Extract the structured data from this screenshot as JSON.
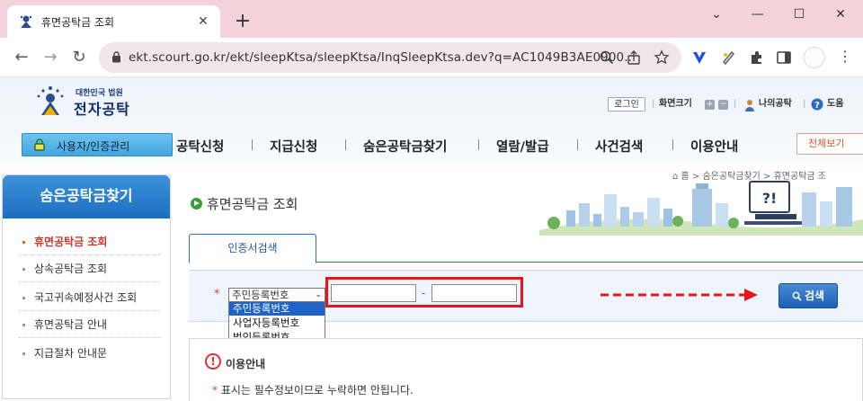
{
  "browser": {
    "tab_title": "휴면공탁금 조회",
    "tab_close": "✕",
    "new_tab": "+",
    "url": "ekt.scourt.go.kr/ekt/sleepKtsa/sleepKtsa/InqSleepKtsa.dev?q=AC1049B3AE0900...",
    "window_controls": [
      "⌄",
      "—",
      "☐",
      "✕"
    ],
    "icons": [
      "back-icon",
      "forward-icon",
      "reload-icon",
      "lock-icon",
      "zoom-icon",
      "share-icon",
      "bookmark-star-icon",
      "extension-icons",
      "puzzle-icon",
      "sidepanel-icon",
      "profile-icon",
      "menu-icon"
    ]
  },
  "site": {
    "logo_small": "대한민국 법원",
    "logo_big": "전자공탁",
    "util": {
      "login": "로그인",
      "font_size": "화면크기",
      "plus": "+",
      "minus": "−",
      "my": "나의공탁",
      "help": "도움"
    },
    "user_button": "사용자/인증관리",
    "gnb": [
      "공탁신청",
      "지급신청",
      "숨은공탁금찾기",
      "열람/발급",
      "사건검색",
      "이용안내"
    ],
    "all_view": "전체보기",
    "breadcrumb": "⌂ 홈 > 숨은공탁금찾기 > 휴면공탁금 조",
    "sidebar": {
      "title": "숨은공탁금찾기",
      "items": [
        {
          "label": "휴면공탁금 조회",
          "active": true
        },
        {
          "label": "상속공탁금 조회",
          "active": false
        },
        {
          "label": "국고귀속예정사건 조회",
          "active": false
        },
        {
          "label": "휴면공탁금 안내",
          "active": false
        },
        {
          "label": "지급절차 안내문",
          "active": false
        }
      ]
    },
    "page_title": "휴면공탁금 조회",
    "tab_cert": "인증서검색",
    "form": {
      "required_mark": "*",
      "select_value": "주민등록번호",
      "select_arrow": "⌄",
      "options": [
        "주민등록번호",
        "사업자등록번호",
        "법인등록번호"
      ],
      "highlighted_option": 0,
      "id_first": "",
      "id_second": "",
      "dash": "-",
      "search_button": "검색"
    },
    "notice": {
      "icon": "!",
      "title": "이용안내",
      "line_star": "*",
      "line_text": "표시는 필수정보이므로 누락하면 안됩니다."
    },
    "colors": {
      "accent_red": "#e8141c",
      "brand_blue": "#1d6ec0",
      "tab_bar": "#f3d2db"
    }
  }
}
